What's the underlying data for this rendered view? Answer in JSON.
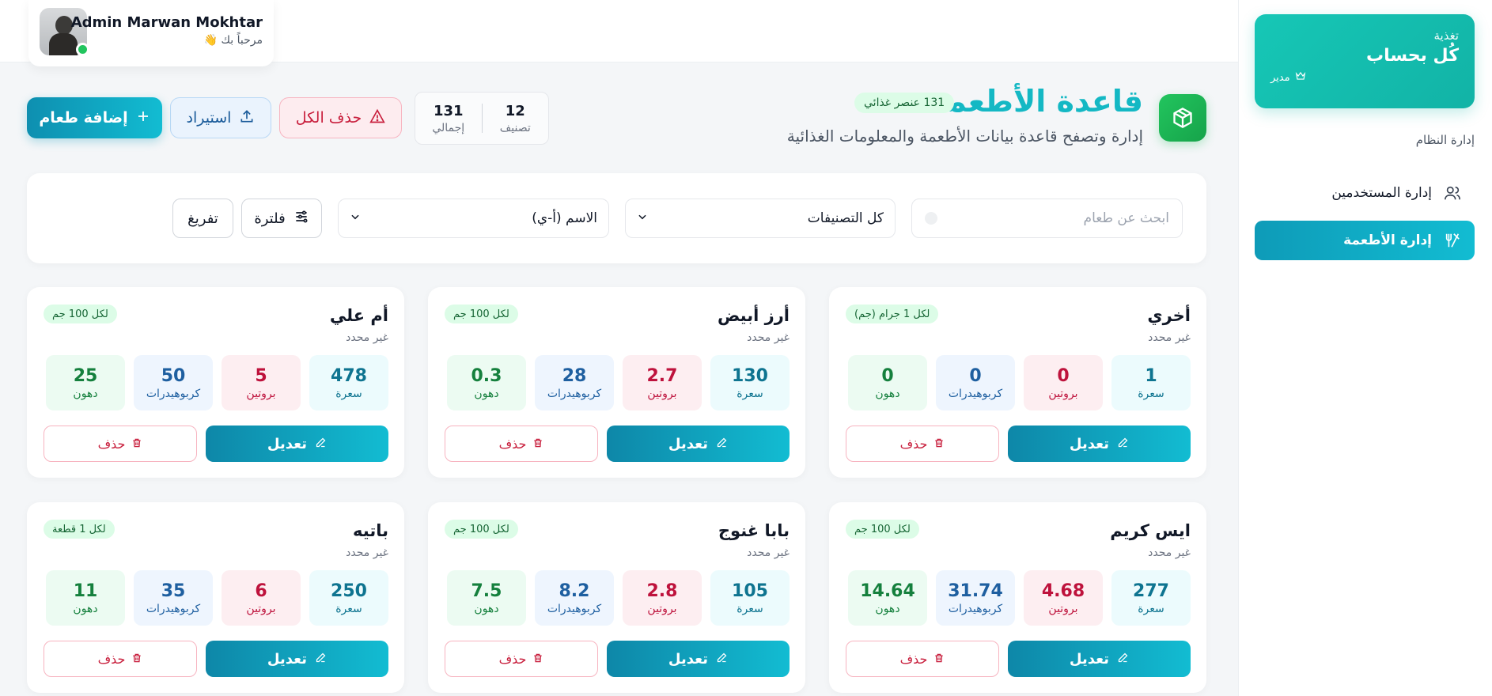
{
  "sidebar": {
    "brand_small": "تغذية",
    "brand_title": "كُل بحساب",
    "brand_role": "مدير",
    "section_label": "إدارة النظام",
    "items": [
      {
        "label": "إدارة المستخدمين"
      },
      {
        "label": "إدارة الأطعمة"
      }
    ]
  },
  "user": {
    "name": "Admin Marwan Mokhtar",
    "greeting": "مرحباً بك 👋"
  },
  "header": {
    "title": "قاعدة الأطعمة",
    "badge": "131 عنصر غذائي",
    "subtitle": "إدارة وتصفح قاعدة بيانات الأطعمة والمعلومات الغذائية",
    "stats": [
      {
        "value": "12",
        "label": "تصنيف"
      },
      {
        "value": "131",
        "label": "إجمالي"
      }
    ],
    "delete_all_label": "حذف الكل",
    "import_label": "استيراد",
    "add_label": "إضافة طعام"
  },
  "filters": {
    "search_placeholder": "ابحث عن طعام",
    "category_value": "كل التصنيفات",
    "sort_value": "الاسم (أ-ي)",
    "filter_label": "فلترة",
    "clear_label": "تفريغ"
  },
  "card_labels": {
    "calories": "سعرة",
    "protein": "بروتين",
    "carbs": "كربوهيدرات",
    "fat": "دهون",
    "edit": "تعديل",
    "delete": "حذف"
  },
  "foods": [
    {
      "name": "أخري",
      "category": "غير محدد",
      "serving": "لكل 1 جرام (جم)",
      "calories": "1",
      "protein": "0",
      "carbs": "0",
      "fat": "0"
    },
    {
      "name": "أرز أبيض",
      "category": "غير محدد",
      "serving": "لكل 100 جم",
      "calories": "130",
      "protein": "2.7",
      "carbs": "28",
      "fat": "0.3"
    },
    {
      "name": "أم علي",
      "category": "غير محدد",
      "serving": "لكل 100 جم",
      "calories": "478",
      "protein": "5",
      "carbs": "50",
      "fat": "25"
    },
    {
      "name": "ايس كريم",
      "category": "غير محدد",
      "serving": "لكل 100 جم",
      "calories": "277",
      "protein": "4.68",
      "carbs": "31.74",
      "fat": "14.64"
    },
    {
      "name": "بابا غنوج",
      "category": "غير محدد",
      "serving": "لكل 100 جم",
      "calories": "105",
      "protein": "2.8",
      "carbs": "8.2",
      "fat": "7.5"
    },
    {
      "name": "باتيه",
      "category": "غير محدد",
      "serving": "لكل 1 قطعة",
      "calories": "250",
      "protein": "6",
      "carbs": "35",
      "fat": "11"
    }
  ],
  "colors": {
    "accent": "#12bcd2",
    "brand": "#16c7b6",
    "danger": "#c81e3c",
    "success": "#22c55e"
  }
}
